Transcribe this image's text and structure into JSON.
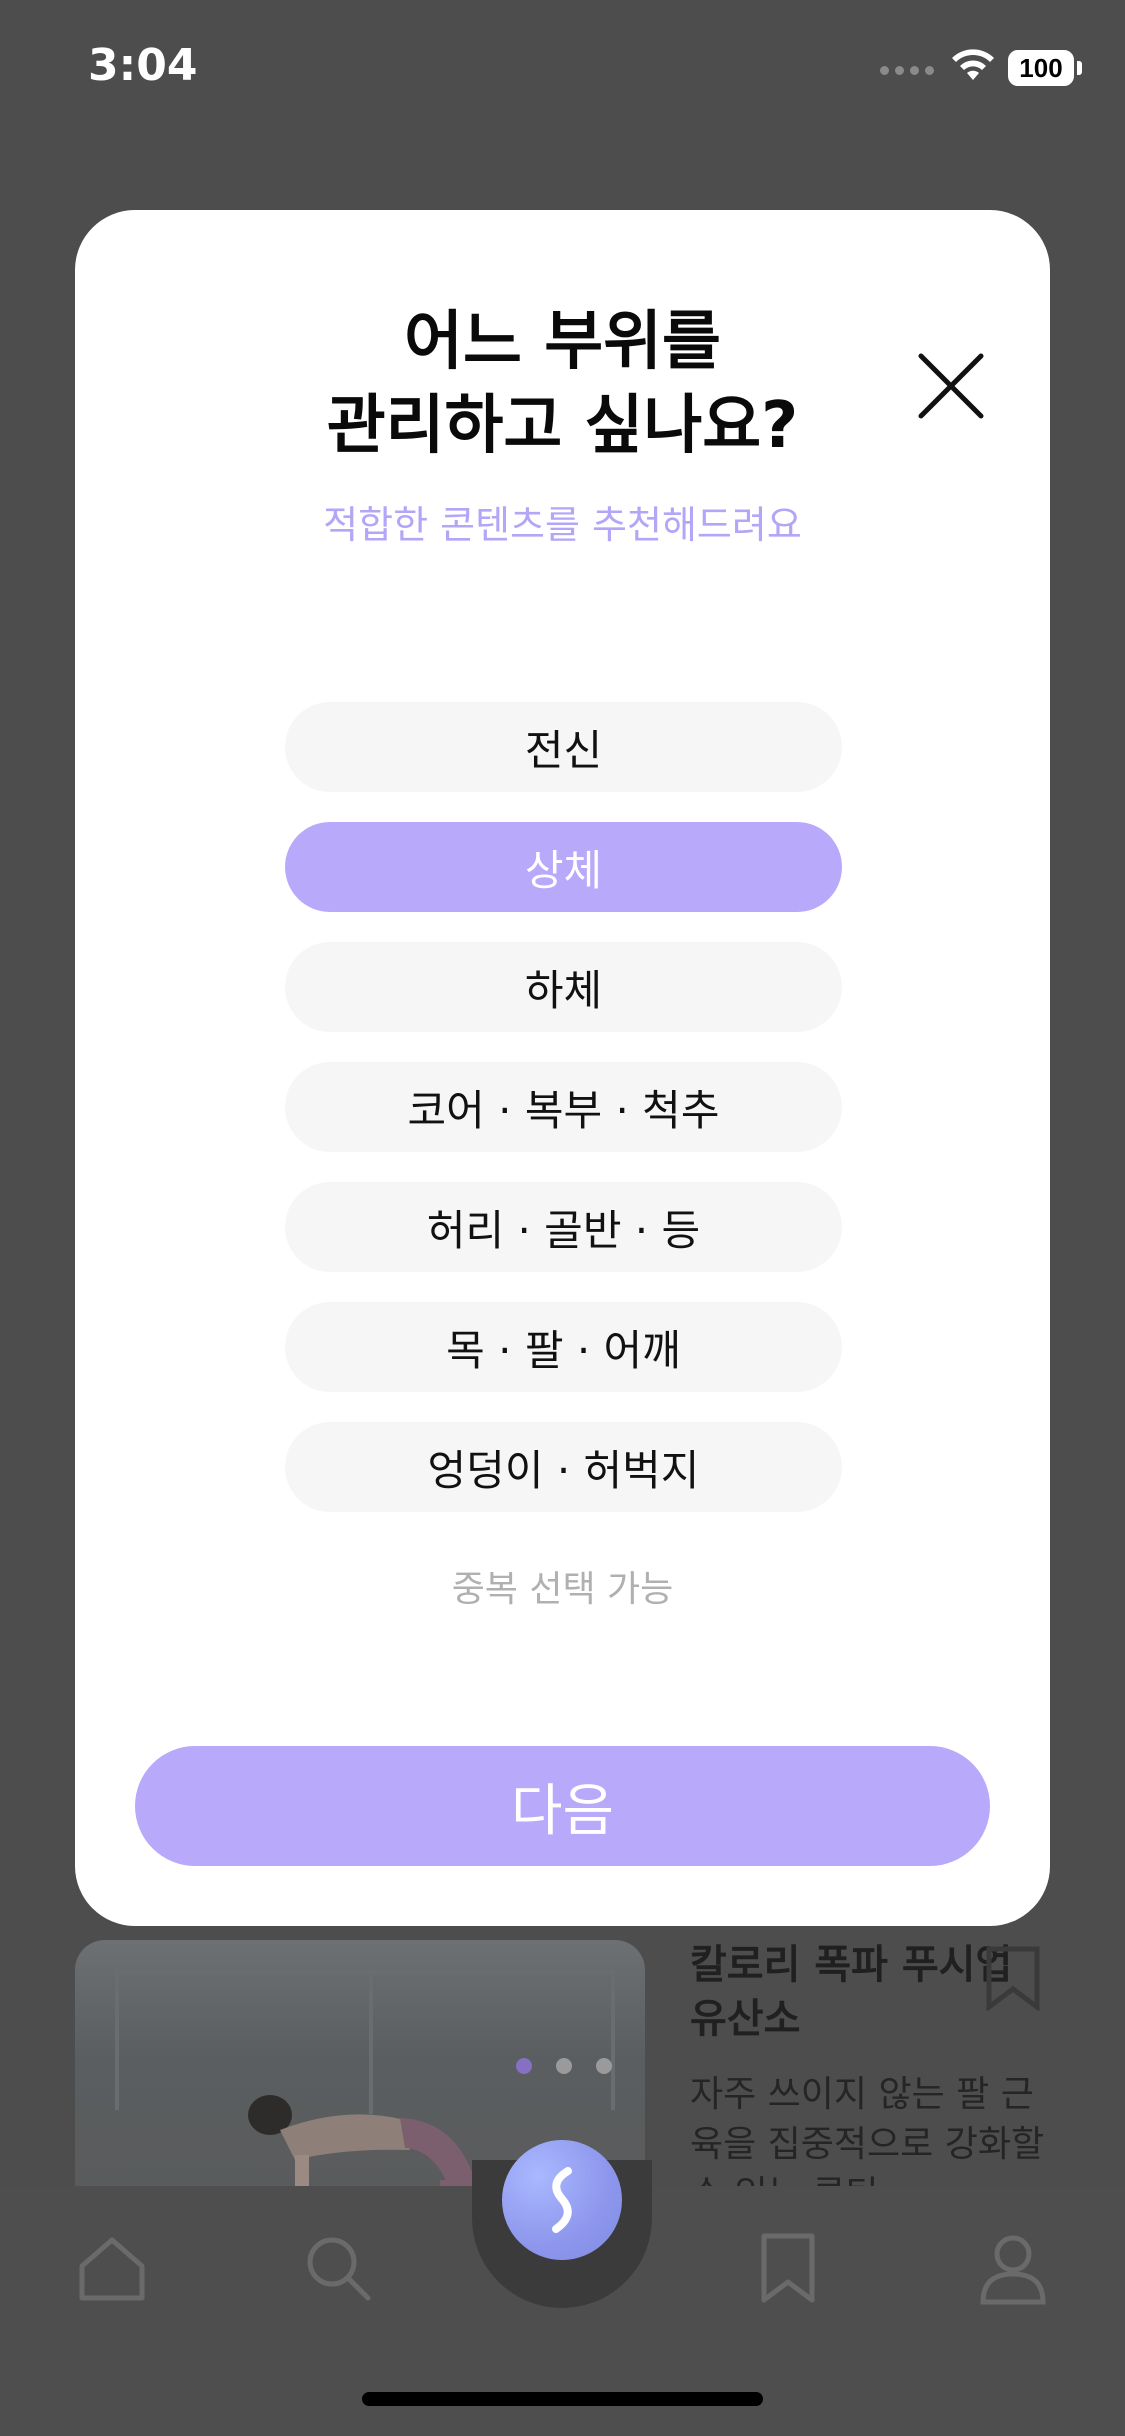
{
  "status_bar": {
    "time": "3:04",
    "battery": "100"
  },
  "background": {
    "article": {
      "title": "칼로리 폭파 푸시업 유산소",
      "description": "자주 쓰이지 않는 팔 근육을 집중적으로 강화할 수 있는 루틴"
    },
    "carousel": {
      "total_dots": 3,
      "active_index": 0
    }
  },
  "modal": {
    "title_line1": "어느 부위를",
    "title_line2": "관리하고 싶나요?",
    "subtitle": "적합한 콘텐츠를 추천해드려요",
    "options": [
      {
        "label": "전신",
        "selected": false
      },
      {
        "label": "상체",
        "selected": true
      },
      {
        "label": "하체",
        "selected": false
      },
      {
        "label": "코어 · 복부 · 척추",
        "selected": false
      },
      {
        "label": "허리 · 골반 · 등",
        "selected": false
      },
      {
        "label": "목 · 팔 · 어깨",
        "selected": false
      },
      {
        "label": "엉덩이 · 허벅지",
        "selected": false
      }
    ],
    "multi_select_hint": "중복 선택 가능",
    "next_label": "다음"
  },
  "tab_bar": {
    "icons": [
      "home-icon",
      "search-icon",
      "center-logo-icon",
      "bookmark-icon",
      "profile-icon"
    ]
  },
  "colors": {
    "accent": "#b8a9fb",
    "subtitle": "#b3a5f8",
    "option_bg": "#f6f6f6",
    "dim_overlay": "#4d4d4d"
  }
}
